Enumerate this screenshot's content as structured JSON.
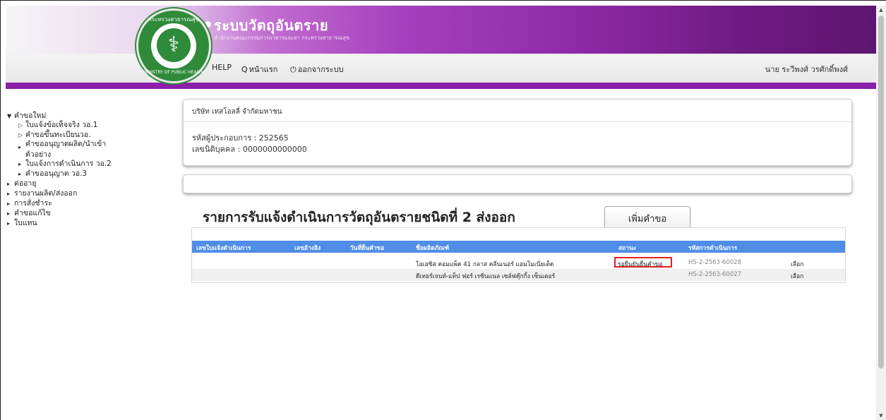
{
  "header": {
    "logo_top_text": "กระทรวงสาธารณสุข",
    "logo_bottom_text": "MINISTRY OF PUBLIC HEALTH",
    "app_title": "ระบบวัตถุอันตราย",
    "app_subtitle": "สำนักงานคณะกรรมการอาหารและยา กระทรวงสาธารณสุข",
    "nav": {
      "help": "HELP",
      "home": "หน้าแรก",
      "logout": "ออกจากระบบ"
    },
    "user_name": "นาย ระวีพงศ์ วรศักดิ์พงศ์",
    "colors": {
      "brand_purple": "#8b1fa8",
      "logo_green": "#2f8a3a"
    }
  },
  "sidebar": {
    "items": [
      {
        "label": "คำขอใหม่",
        "icon": "caret-down-icon"
      },
      {
        "label": "ใบแจ้งข้อเท็จจริง วอ.1",
        "icon": "caret-right-outline-icon"
      },
      {
        "label": "คำขอขึ้นทะเบียนวอ.",
        "icon": "caret-right-outline-icon"
      },
      {
        "label": "คำขออนุญาตผลิต/นำเข้า",
        "icon": "caret-right-icon"
      },
      {
        "label": "ตัวอย่าง",
        "icon": ""
      },
      {
        "label": "ใบแจ้งการดำเนินการ วอ.2",
        "icon": "caret-right-icon"
      },
      {
        "label": "คำขออนุญาต วอ.3",
        "icon": "caret-right-icon"
      },
      {
        "label": "ต่ออายุ",
        "icon": "caret-right-icon"
      },
      {
        "label": "รายงานผลิต/ส่งออก",
        "icon": "caret-right-icon"
      },
      {
        "label": "การสั่งชำระ",
        "icon": "caret-right-icon"
      },
      {
        "label": "คำขอแก้ไข",
        "icon": "caret-right-icon"
      },
      {
        "label": "ใบแทน",
        "icon": "caret-right-icon"
      }
    ]
  },
  "company": {
    "name": "บริษัท เทสโอลลี่ จำกัดมหาชน",
    "operator_code": "รหัสผู้ประกอบการ : 252565",
    "juristic_id": "เลขนิติบุคคล : 0000000000000"
  },
  "section": {
    "title": "รายการรับแจ้งดำเนินการวัตถุอันตรายชนิดที่ 2 ส่งออก",
    "add_button": "เพิ่มคำขอ"
  },
  "table": {
    "columns": [
      "เลขใบแจ้งดำเนินการ",
      "เลขอ้างอิง",
      "วันที่ยื่นคำขอ",
      "ชื่อผลิตภัณฑ์",
      "สถานะ",
      "รหัสการดำเนินการ"
    ],
    "rows": [
      {
        "product": "โอเอซิส คอมแพ็ค 41 กลาส คลีนเนอร์ แอมโมเนียเต็ด",
        "status": "รอยืนยันยื่นคำขอ",
        "code": "HS-2-2563-60028",
        "action": "เลือก"
      },
      {
        "product": "ดีเทอร์เจนท์-แท็ป ฟอร์ เรซิ่นแนล เซล์ฟคุ๊กกิ้ง เซ็นเตอร์",
        "status": "",
        "code": "HS-2-2563-60027",
        "action": "เลือก"
      }
    ]
  }
}
